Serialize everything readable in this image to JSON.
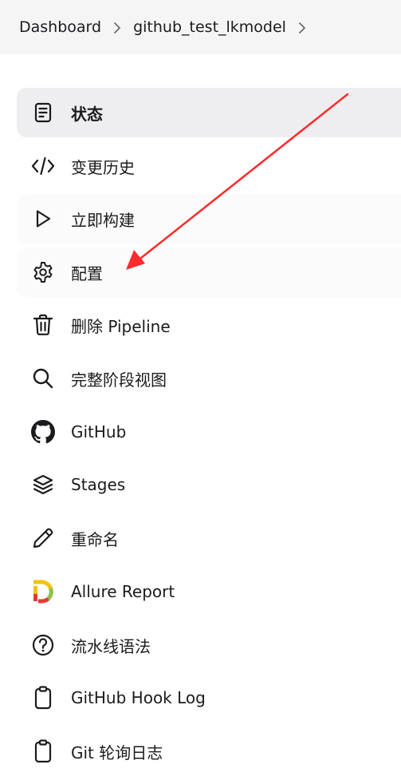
{
  "breadcrumb": {
    "items": [
      "Dashboard",
      "github_test_lkmodel"
    ]
  },
  "nav": {
    "items": [
      {
        "label": "状态",
        "icon": "status-document-icon",
        "active": true
      },
      {
        "label": "变更历史",
        "icon": "code-brackets-icon"
      },
      {
        "label": "立即构建",
        "icon": "play-icon"
      },
      {
        "label": "配置",
        "icon": "gear-icon"
      },
      {
        "label": "删除 Pipeline",
        "icon": "trash-icon"
      },
      {
        "label": "完整阶段视图",
        "icon": "search-icon"
      },
      {
        "label": "GitHub",
        "icon": "github-icon"
      },
      {
        "label": "Stages",
        "icon": "layers-icon"
      },
      {
        "label": "重命名",
        "icon": "pencil-icon"
      },
      {
        "label": "Allure Report",
        "icon": "allure-logo-icon"
      },
      {
        "label": "流水线语法",
        "icon": "help-circle-icon"
      },
      {
        "label": "GitHub Hook Log",
        "icon": "clipboard-icon"
      },
      {
        "label": "Git 轮询日志",
        "icon": "clipboard-icon"
      }
    ]
  },
  "annotation": {
    "arrow_color": "#ff2a2a"
  },
  "colors": {
    "breadcrumb_bg": "#f5f5f6",
    "active_bg": "#eeeef0",
    "text": "#1b1b1f"
  }
}
